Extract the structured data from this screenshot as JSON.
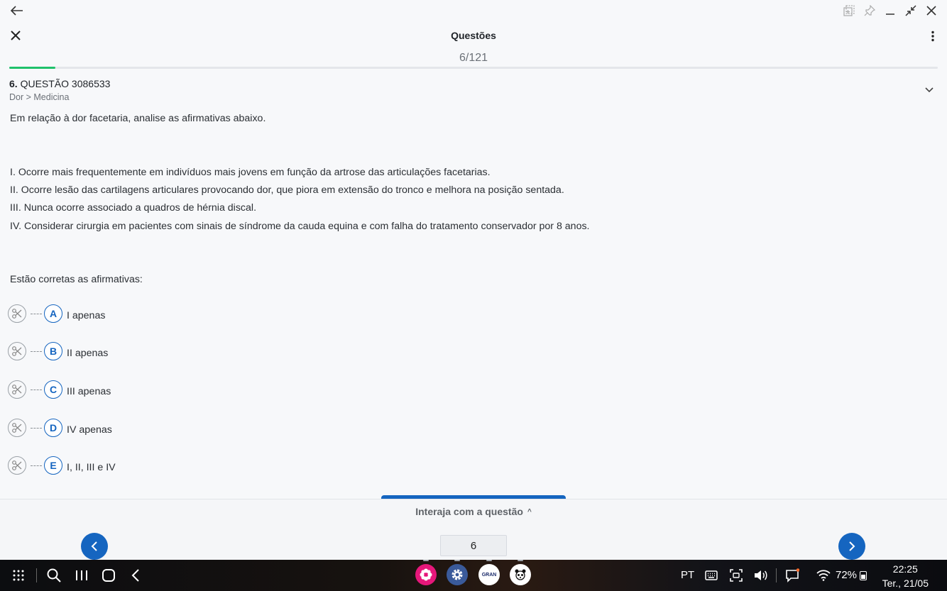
{
  "window": {
    "back_label": "←"
  },
  "app": {
    "title": "Questões",
    "counter": "6/121",
    "progress_fraction": 0.05
  },
  "question": {
    "number": "6.",
    "label": "QUESTÃO 3086533",
    "breadcrumb": "Dor > Medicina",
    "intro": "Em relação à dor facetaria, analise as afirmativas abaixo.",
    "statements": [
      "I. Ocorre mais frequentemente em indivíduos mais jovens em função da artrose das articulações facetarias.",
      "II. Ocorre lesão das cartilagens articulares provocando dor, que piora em extensão do tronco e melhora na posição sentada.",
      "III. Nunca ocorre associado a quadros de hérnia discal.",
      "IV. Considerar cirurgia em pacientes com sinais de síndrome da cauda equina e com falha do tratamento conservador por 8 anos."
    ],
    "prompt": "Estão corretas as afirmativas:",
    "options": [
      {
        "letter": "A",
        "text": "I apenas"
      },
      {
        "letter": "B",
        "text": "II apenas"
      },
      {
        "letter": "C",
        "text": "III apenas"
      },
      {
        "letter": "D",
        "text": "IV apenas"
      },
      {
        "letter": "E",
        "text": "I, II, III e IV"
      }
    ]
  },
  "panel": {
    "interact_label": "Interaja com a questão",
    "page_value": "6"
  },
  "taskbar": {
    "language": "PT",
    "battery": "72%",
    "time": "22:25",
    "date": "Ter., 21/05",
    "apps": [
      "flower-app-icon",
      "settings-app-icon",
      "gran-app-icon",
      "panda-app-icon"
    ],
    "gran_label": "GRAN"
  },
  "colors": {
    "accent": "#1565c0",
    "progress": "#1fc16b"
  }
}
